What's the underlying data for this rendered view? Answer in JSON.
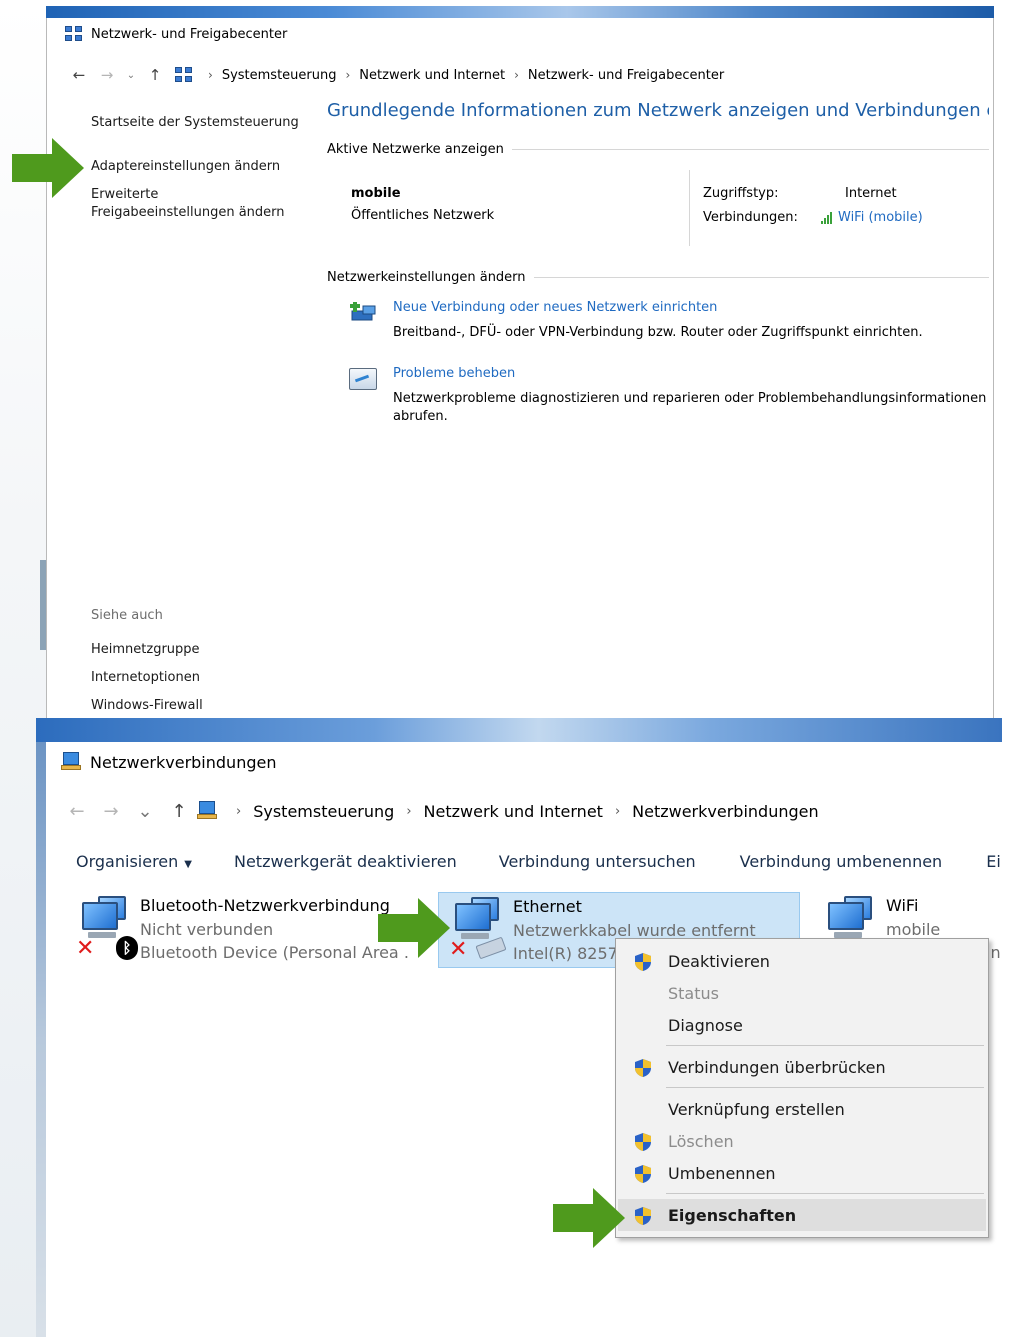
{
  "window1": {
    "title": "Netzwerk- und Freigabecenter",
    "breadcrumbs": [
      "Systemsteuerung",
      "Netzwerk und Internet",
      "Netzwerk- und Freigabecenter"
    ],
    "sidebar": {
      "home": "Startseite der Systemsteuerung",
      "adapter": "Adaptereinstellungen ändern",
      "advanced_line1": "Erweiterte",
      "advanced_line2": "Freigabeeinstellungen ändern"
    },
    "see_also": {
      "heading": "Siehe auch",
      "links": [
        "Heimnetzgruppe",
        "Internetoptionen",
        "Windows-Firewall"
      ]
    },
    "main": {
      "title": "Grundlegende Informationen zum Netzwerk anzeigen und Verbindungen einric",
      "active_heading": "Aktive Netzwerke anzeigen",
      "network_name": "mobile",
      "network_type": "Öffentliches Netzwerk",
      "access_label": "Zugriffstyp:",
      "access_value": "Internet",
      "connections_label": "Verbindungen:",
      "connections_value": "WiFi (mobile)",
      "change_heading": "Netzwerkeinstellungen ändern",
      "task1_link": "Neue Verbindung oder neues Netzwerk einrichten",
      "task1_desc": "Breitband-, DFÜ- oder VPN-Verbindung bzw. Router oder Zugriffspunkt einrichten.",
      "task2_link": "Probleme beheben",
      "task2_desc": "Netzwerkprobleme diagnostizieren und reparieren oder Problembehandlungsinformationen abrufen."
    }
  },
  "window2": {
    "title": "Netzwerkverbindungen",
    "breadcrumbs": [
      "Systemsteuerung",
      "Netzwerk und Internet",
      "Netzwerkverbindungen"
    ],
    "toolbar": {
      "organize": "Organisieren",
      "disable": "Netzwerkgerät deaktivieren",
      "diagnose": "Verbindung untersuchen",
      "rename": "Verbindung umbenennen",
      "settings": "Einste"
    },
    "adapters": [
      {
        "name": "Bluetooth-Netzwerkverbindung",
        "status": "Nicht verbunden",
        "device": "Bluetooth Device (Personal Area ..."
      },
      {
        "name": "Ethernet",
        "status": "Netzwerkkabel wurde entfernt",
        "device": "Intel(R) 8257"
      },
      {
        "name": "WiFi",
        "status": "mobile",
        "device": "in"
      }
    ],
    "context_menu": [
      {
        "label": "Deaktivieren",
        "shield": true,
        "disabled": false
      },
      {
        "label": "Status",
        "shield": false,
        "disabled": true
      },
      {
        "label": "Diagnose",
        "shield": false,
        "disabled": false
      },
      {
        "label": "Verbindungen überbrücken",
        "shield": true,
        "disabled": false
      },
      {
        "label": "Verknüpfung erstellen",
        "shield": false,
        "disabled": false
      },
      {
        "label": "Löschen",
        "shield": true,
        "disabled": true
      },
      {
        "label": "Umbenennen",
        "shield": true,
        "disabled": false
      },
      {
        "label": "Eigenschaften",
        "shield": true,
        "disabled": false
      }
    ]
  },
  "colors": {
    "link": "#1f6ac1",
    "title_blue": "#1e5fa7",
    "arrow_green": "#4f9a1d",
    "selection": "#cce4f7"
  }
}
